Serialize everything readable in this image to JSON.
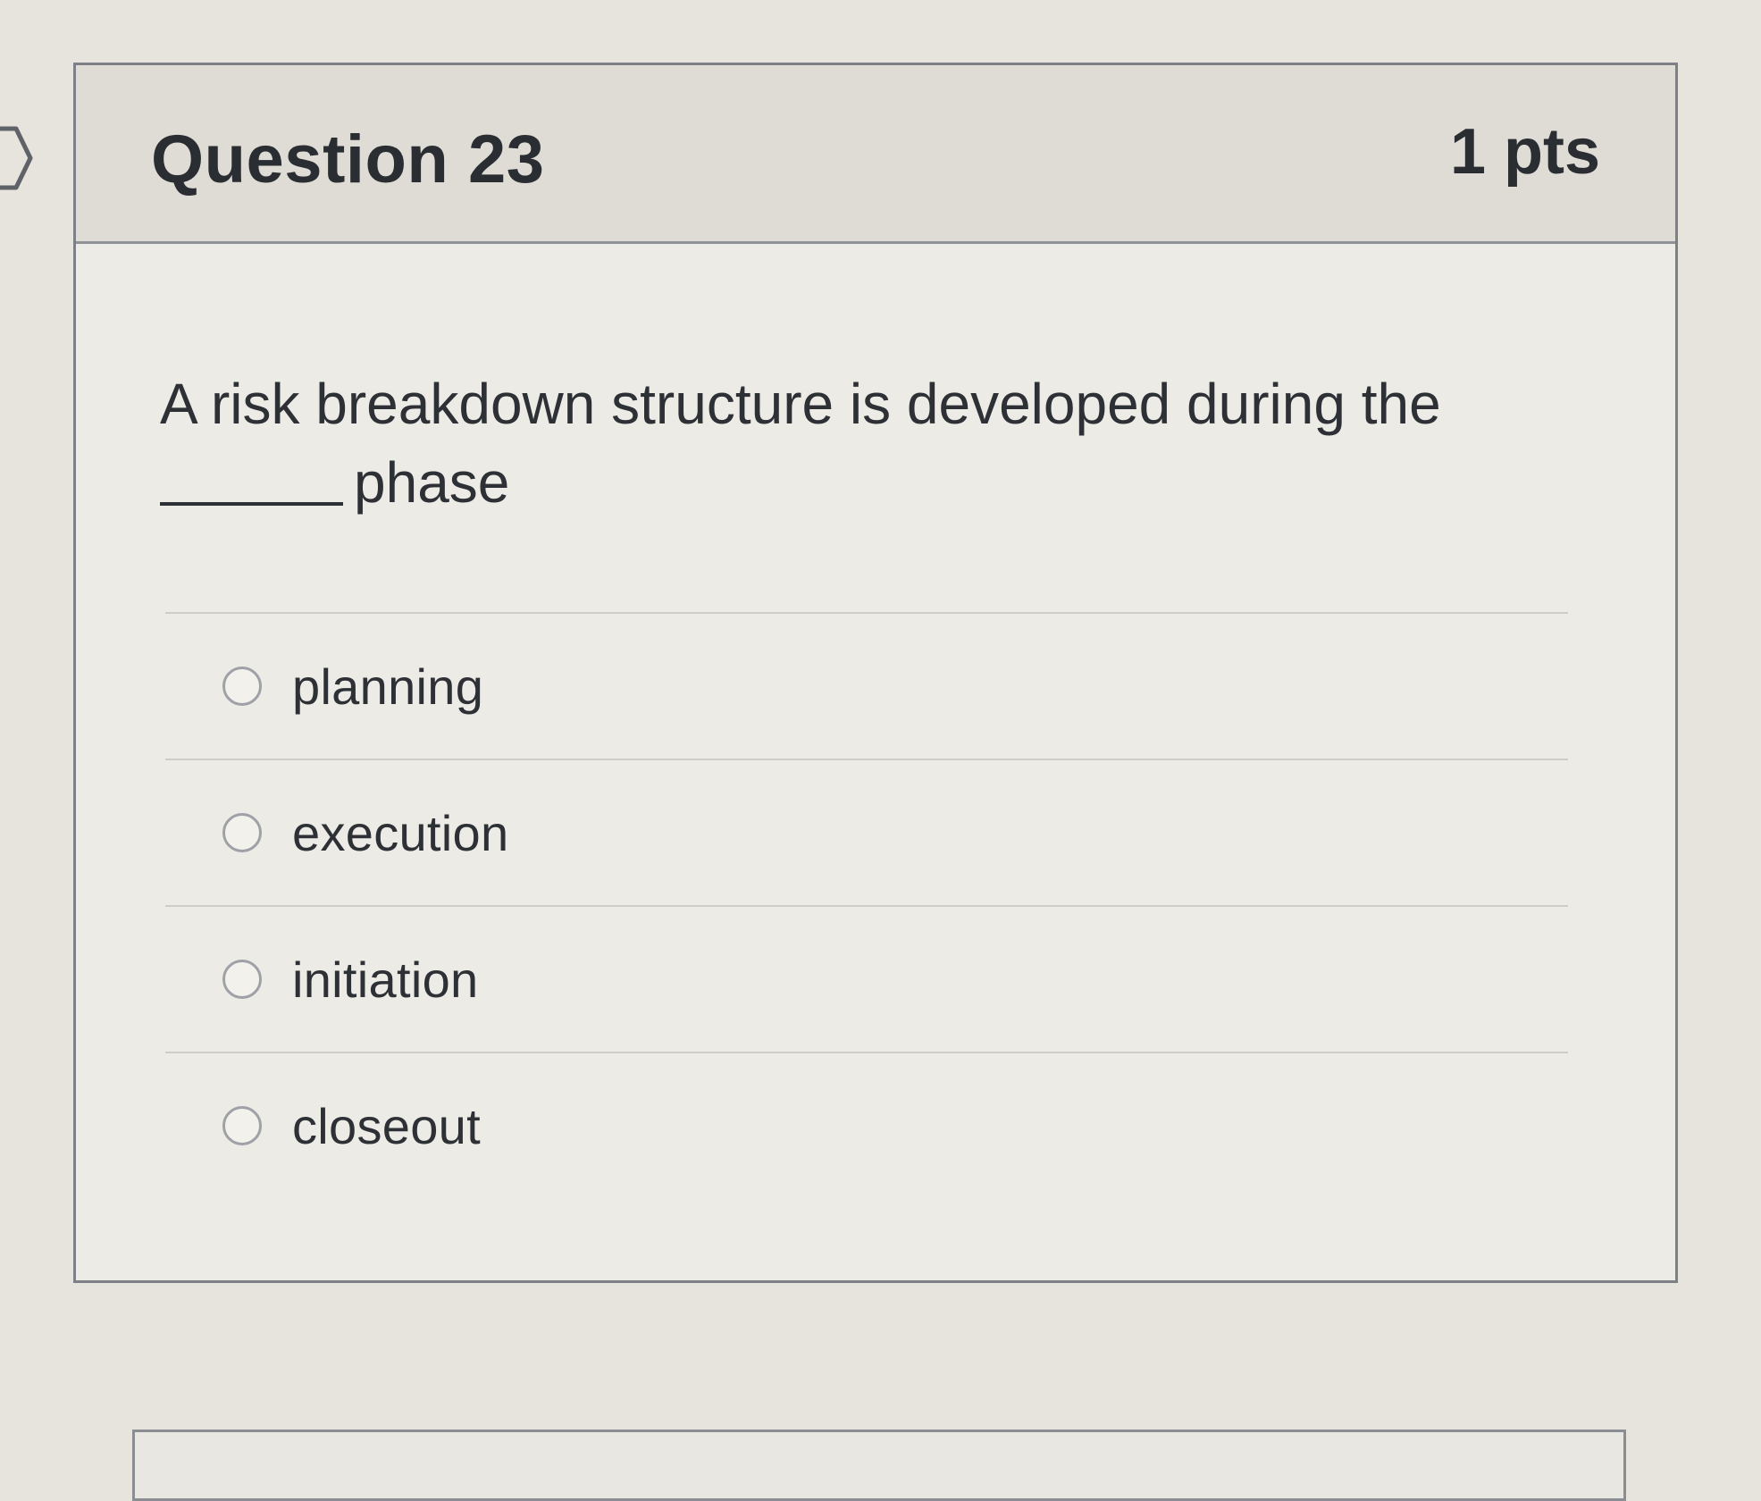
{
  "question": {
    "title": "Question 23",
    "points": "1 pts",
    "text_line1": "A risk breakdown structure is developed during the",
    "text_line2": "phase"
  },
  "answers": [
    {
      "label": "planning",
      "selected": false
    },
    {
      "label": "execution",
      "selected": false
    },
    {
      "label": "initiation",
      "selected": false
    },
    {
      "label": "closeout",
      "selected": false
    }
  ],
  "icons": {
    "flag": "bookmark-flag-icon",
    "radio": "radio-button-icon"
  },
  "colors": {
    "header_background": "#dedcd5",
    "card_background": "#ecebe6",
    "border": "#7d8187",
    "text": "#2b2e33"
  }
}
